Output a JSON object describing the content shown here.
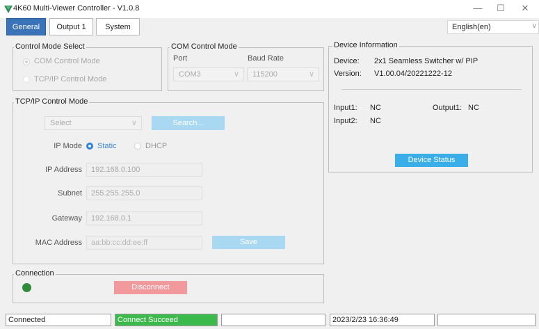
{
  "window": {
    "title": "4K60 Multi-Viewer Controller - V1.0.8",
    "minimize": "—",
    "maximize": "☐",
    "close": "✕"
  },
  "tabs": [
    "General",
    "Output 1",
    "System"
  ],
  "active_tab": "General",
  "language": {
    "value": "English(en)",
    "chevron": "∨"
  },
  "control_mode": {
    "legend": "Control Mode Select",
    "option_com": "COM Control Mode",
    "option_tcpip": "TCP/IP Control Mode"
  },
  "com_mode": {
    "legend": "COM Control Mode",
    "port_label": "Port",
    "baud_label": "Baud Rate",
    "port_value": "COM3",
    "baud_value": "115200"
  },
  "tcpip": {
    "legend": "TCP/IP Control Mode",
    "select_value": "Select",
    "search_label": "Search...",
    "ip_mode_label": "IP Mode",
    "ip_mode_static": "Static",
    "ip_mode_dhcp": "DHCP",
    "ip_label": "IP Address",
    "ip_value": "192.168.0.100",
    "subnet_label": "Subnet",
    "subnet_value": "255.255.255.0",
    "gateway_label": "Gateway",
    "gateway_value": "192.168.0.1",
    "mac_label": "MAC Address",
    "mac_placeholder": "aa:bb:cc:dd:ee:ff",
    "save_label": "Save"
  },
  "connection": {
    "legend": "Connection",
    "indicator_color": "#2e8b3a",
    "disconnect_label": "Disconnect"
  },
  "device_info": {
    "legend": "Device Information",
    "device_label": "Device:",
    "device_value": "2x1 Seamless Switcher w/ PIP",
    "version_label": "Version:",
    "version_value": "V1.00.04/20221222-12",
    "input1_label": "Input1:",
    "input1_value": "NC",
    "input2_label": "Input2:",
    "input2_value": "NC",
    "output1_label": "Output1:",
    "output1_value": "NC",
    "status_button": "Device Status"
  },
  "statusbar": {
    "state": "Connected",
    "message": "Connect Succeed",
    "empty1": "",
    "timestamp": "2023/2/23 16:36:49",
    "empty2": ""
  },
  "colors": {
    "accent": "#3a73b8",
    "button": "#3aaee8",
    "button_disabled": "#a8d8f2",
    "danger_disabled": "#f1999c",
    "success": "#3cb94b"
  }
}
